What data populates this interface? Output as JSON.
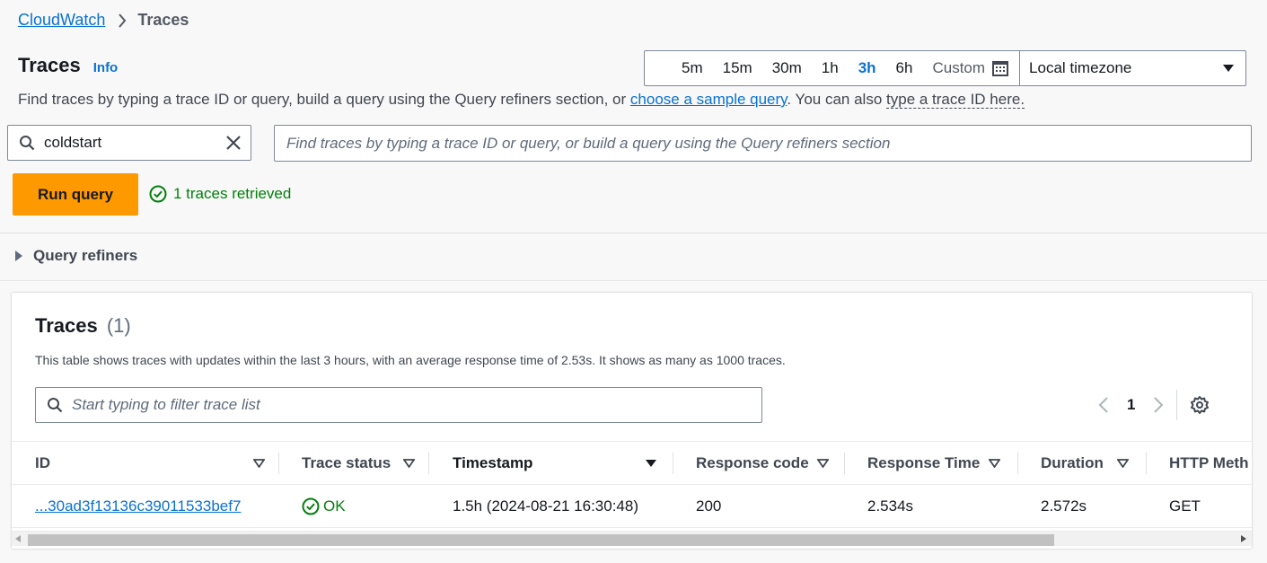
{
  "breadcrumb": {
    "root": "CloudWatch",
    "current": "Traces"
  },
  "page": {
    "title": "Traces",
    "info": "Info",
    "description_pre": "Find traces by typing a trace ID or query, build a query using the Query refiners section, or ",
    "description_link": "choose a sample query",
    "description_mid": ". You can also ",
    "description_dotted": "type a trace ID here."
  },
  "time_range": {
    "options": [
      "5m",
      "15m",
      "30m",
      "1h",
      "3h",
      "6h"
    ],
    "selected": "3h",
    "custom_label": "Custom",
    "timezone": "Local timezone"
  },
  "group_search": {
    "value": "coldstart"
  },
  "query_input": {
    "placeholder": "Find traces by typing a trace ID or query, or build a query using the Query refiners section"
  },
  "run_query": {
    "label": "Run query"
  },
  "status": {
    "text": "1 traces retrieved"
  },
  "refiners": {
    "label": "Query refiners"
  },
  "traces_panel": {
    "title": "Traces",
    "count": "(1)",
    "description": "This table shows traces with updates within the last 3 hours, with an average response time of 2.53s. It shows as many as 1000 traces.",
    "filter_placeholder": "Start typing to filter trace list",
    "page": "1",
    "columns": [
      "ID",
      "Trace status",
      "Timestamp",
      "Response code",
      "Response Time",
      "Duration",
      "HTTP Meth"
    ],
    "sorted_column": "Timestamp",
    "rows": [
      {
        "id": "...30ad3f13136c39011533bef7",
        "status": "OK",
        "timestamp": "1.5h (2024-08-21 16:30:48)",
        "response_code": "200",
        "response_time": "2.534s",
        "duration": "2.572s",
        "http_method": "GET"
      }
    ]
  },
  "colors": {
    "link": "#0972d3",
    "primary_button": "#ff9900",
    "success": "#037f0c"
  }
}
